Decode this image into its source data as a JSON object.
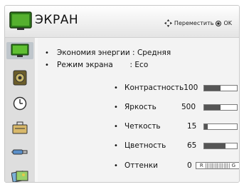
{
  "header": {
    "title": "ЭКРАН",
    "hint_move": "Переместить",
    "hint_ok": "OK"
  },
  "sidebar": {
    "items": [
      {
        "icon": "tv-screen-icon",
        "active": true
      },
      {
        "icon": "speaker-icon",
        "active": false
      },
      {
        "icon": "clock-icon",
        "active": false
      },
      {
        "icon": "toolbox-icon",
        "active": false
      },
      {
        "icon": "input-cable-icon",
        "active": false
      },
      {
        "icon": "photo-media-icon",
        "active": false
      }
    ]
  },
  "settings": {
    "energy": {
      "label": "Экономия энергии",
      "value": "Средняя"
    },
    "mode": {
      "label": "Режим экрана",
      "value": "Eco"
    }
  },
  "adjustments": [
    {
      "label": "Контрастность",
      "value": "100",
      "level": 0.5
    },
    {
      "label": "Яркость",
      "value": "500",
      "level": 0.5
    },
    {
      "label": "Четкость",
      "value": "15",
      "level": 0.1
    },
    {
      "label": "Цветность",
      "value": "65",
      "level": 0.65
    },
    {
      "label": "Оттенки",
      "value": "0",
      "scale_left": "R",
      "scale_right": "G"
    }
  ],
  "colors": {
    "bar_fill": "#555555",
    "sidebar_bg": "#dedede",
    "active_bg": "#bfc6cc"
  }
}
